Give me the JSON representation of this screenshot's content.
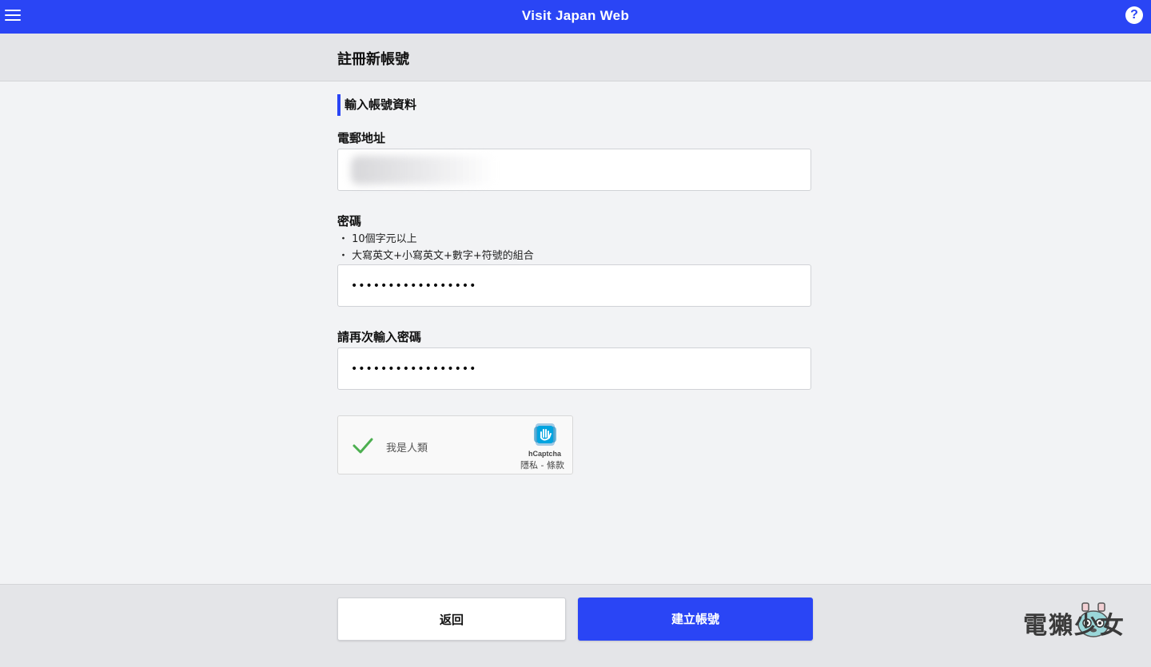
{
  "header": {
    "app_title": "Visit Japan Web",
    "menu_icon": "hamburger-menu-icon",
    "help_icon": "question-circle-icon",
    "help_symbol": "?"
  },
  "page": {
    "title": "註冊新帳號",
    "section_title": "輸入帳號資料"
  },
  "form": {
    "email": {
      "label": "電郵地址",
      "value": ""
    },
    "password": {
      "label": "密碼",
      "hints": [
        "・ 10個字元以上",
        "・ 大寫英文+小寫英文+數字+符號的組合"
      ],
      "value": "•••••••••••••••••"
    },
    "confirm_password": {
      "label": "請再次輸入密碼",
      "value": "•••••••••••••••••"
    }
  },
  "captcha": {
    "label": "我是人類",
    "brand": "hCaptcha",
    "links": "隱私 - 條款",
    "checked": true,
    "check_color": "#4caf50"
  },
  "footer": {
    "back_label": "返回",
    "create_label": "建立帳號"
  },
  "watermark": {
    "text": "電獺少女"
  },
  "colors": {
    "accent": "#2a45f5",
    "background": "#f2f3f5",
    "header_band": "#e4e5e8"
  }
}
